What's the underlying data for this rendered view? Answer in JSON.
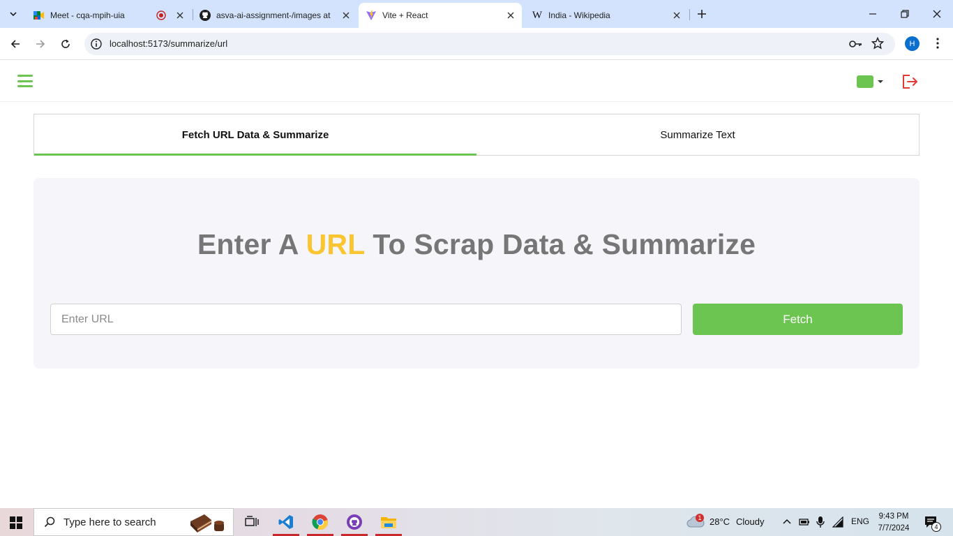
{
  "browser": {
    "tabs": [
      {
        "title": "Meet - cqa-mpih-uia",
        "active": false
      },
      {
        "title": "asva-ai-assignment-/images at",
        "active": false
      },
      {
        "title": "Vite + React",
        "active": true
      },
      {
        "title": "India - Wikipedia",
        "active": false
      }
    ],
    "address": "localhost:5173/summarize/url",
    "profile_initial": "H"
  },
  "app": {
    "header": {
      "theme_color": "#6cc551"
    },
    "tabs": [
      {
        "label": "Fetch URL Data & Summarize",
        "active": true
      },
      {
        "label": "Summarize Text",
        "active": false
      }
    ],
    "card": {
      "heading_before": "Enter A ",
      "heading_accent": "URL",
      "heading_after": " To Scrap Data & Summarize",
      "url_placeholder": "Enter URL",
      "url_value": "",
      "fetch_label": "Fetch"
    }
  },
  "taskbar": {
    "search_placeholder": "Type here to search",
    "weather_temp": "28°C",
    "weather_text": "Cloudy",
    "weather_badge": "1",
    "language": "ENG",
    "time": "9:43 PM",
    "date": "7/7/2024",
    "notifications": "4"
  },
  "colors": {
    "accent": "#6cc551",
    "heading": "#767676",
    "highlight": "#fbc531",
    "logout": "#e53935"
  }
}
